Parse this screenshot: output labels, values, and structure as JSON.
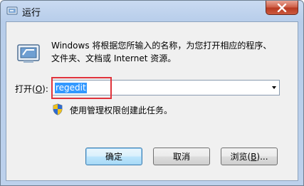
{
  "window": {
    "title": "运行"
  },
  "description": {
    "line1": "Windows 将根据您所输入的名称，为您打开相应的程序、",
    "line2": "文件夹、文档或 Internet 资源。"
  },
  "open": {
    "label_prefix": "打开(",
    "label_access": "O",
    "label_suffix": "):",
    "value": "regedit"
  },
  "admin_note": "使用管理权限创建此任务。",
  "buttons": {
    "ok": "确定",
    "cancel": "取消",
    "browse_prefix": "浏览(",
    "browse_access": "B",
    "browse_suffix": ")..."
  },
  "colors": {
    "highlight_box": "#e0333b",
    "selection": "#3399ff"
  },
  "icons": [
    "run-app-icon",
    "close-icon",
    "run-dialog-icon",
    "uac-shield-icon",
    "dropdown-arrow-icon"
  ]
}
